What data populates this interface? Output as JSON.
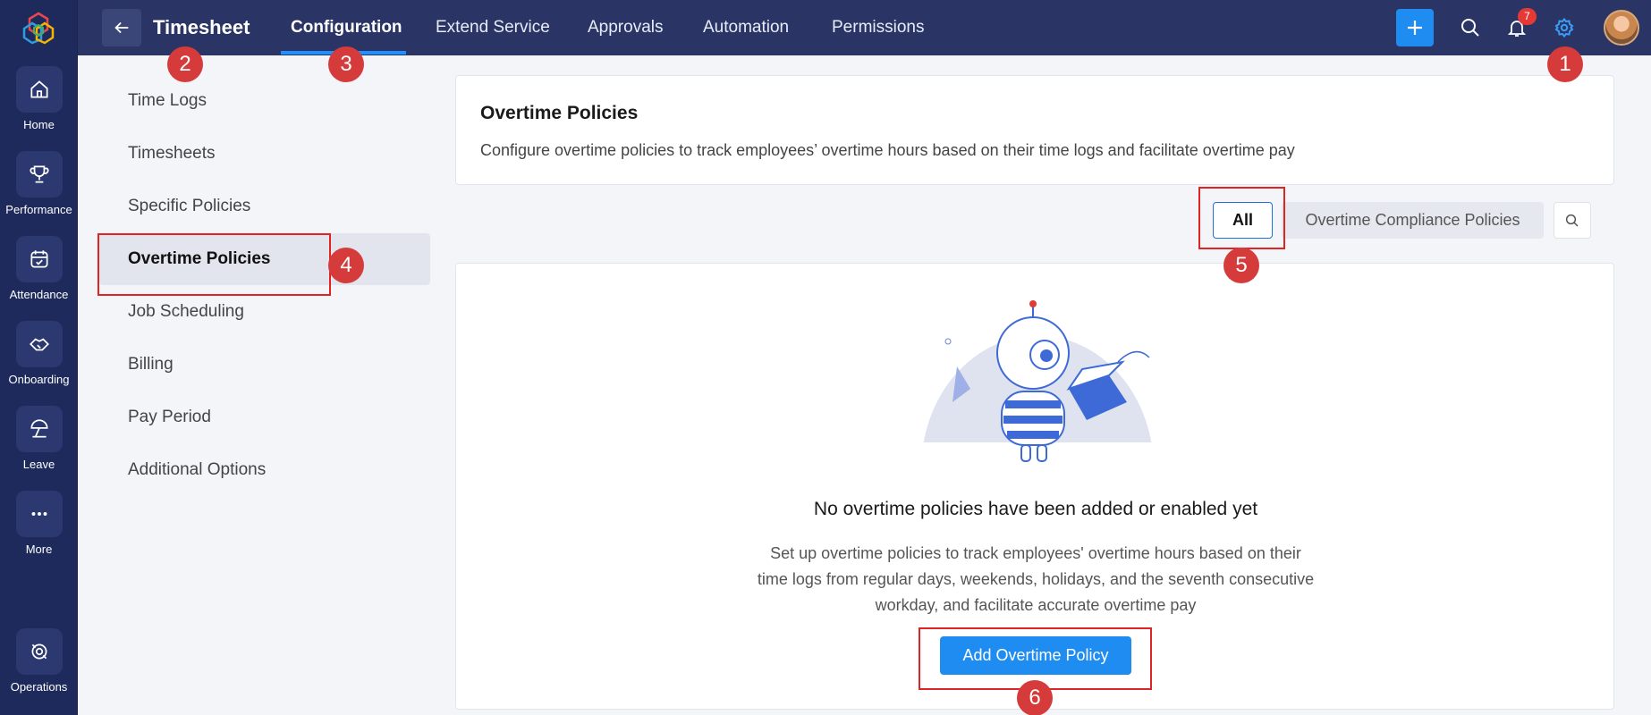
{
  "rail": {
    "items": [
      {
        "label": "Home",
        "icon": "home-icon"
      },
      {
        "label": "Performance",
        "icon": "trophy-icon"
      },
      {
        "label": "Attendance",
        "icon": "calendar-icon"
      },
      {
        "label": "Onboarding",
        "icon": "handshake-icon"
      },
      {
        "label": "Leave",
        "icon": "umbrella-icon"
      },
      {
        "label": "More",
        "icon": "more-icon"
      },
      {
        "label": "Operations",
        "icon": "operations-icon"
      }
    ]
  },
  "header": {
    "title": "Timesheet",
    "tabs": [
      {
        "label": "Configuration",
        "active": true
      },
      {
        "label": "Extend Service"
      },
      {
        "label": "Approvals"
      },
      {
        "label": "Automation"
      },
      {
        "label": "Permissions"
      }
    ],
    "notification_count": "7"
  },
  "subnav": {
    "items": [
      {
        "label": "Time Logs"
      },
      {
        "label": "Timesheets"
      },
      {
        "label": "Specific Policies"
      },
      {
        "label": "Overtime Policies",
        "active": true
      },
      {
        "label": "Job Scheduling"
      },
      {
        "label": "Billing"
      },
      {
        "label": "Pay Period"
      },
      {
        "label": "Additional Options"
      }
    ]
  },
  "main": {
    "title": "Overtime Policies",
    "description": "Configure overtime policies to track employees’ overtime hours based on their time logs and facilitate overtime pay",
    "filters": {
      "all": "All",
      "compliance": "Overtime Compliance Policies"
    },
    "empty_state": {
      "title": "No overtime policies have been added or enabled yet",
      "desc_line1": "Set up overtime policies to track employees' overtime hours based on their",
      "desc_line2": "time logs from regular days, weekends, holidays, and the seventh consecutive",
      "desc_line3": "workday, and facilitate accurate overtime pay",
      "button": "Add Overtime Policy"
    }
  },
  "annotations": [
    "1",
    "2",
    "3",
    "4",
    "5",
    "6"
  ],
  "colors": {
    "rail": "#1f2a5c",
    "topbar": "#2a3565",
    "accent": "#1e8cf0",
    "highlight": "#e02424",
    "marker": "#d63b3b"
  }
}
